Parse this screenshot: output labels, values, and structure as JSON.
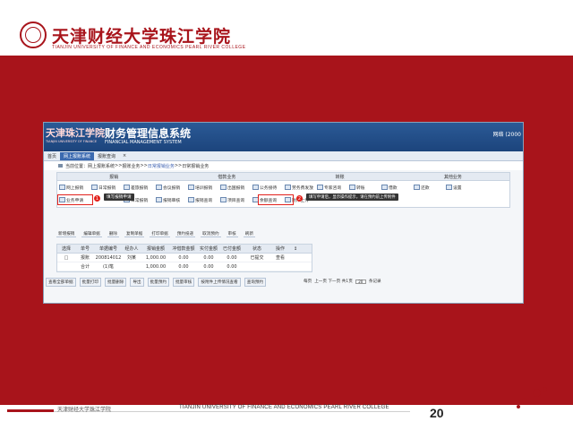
{
  "slide": {
    "logo_cn": "天津财经大学珠江学院",
    "logo_en": "TIANJIN UNIVERSITY OF FINANCE AND ECONOMICS PEARL RIVER COLLEGE",
    "footer_cn": "天津财经大学珠江学院",
    "footer_en": "TIANJIN UNIVERSITY OF FINANCE AND ECONOMICS PEARL RIVER COLLEGE",
    "page_number": "20",
    "colors": {
      "brand": "#a8141b",
      "app_header": "#1c447c",
      "highlight": "#e2211c"
    }
  },
  "app": {
    "logo": "天津珠江学院",
    "logo_sub": "TIANJIN UNIVERSITY OF FINANCE",
    "title": "财务管理信息系统",
    "subtitle": "FINANCIAL MANAGEMENT SYSTEM",
    "user": "网络 (2000",
    "nav": [
      "首页",
      "网上报账系统",
      "报账查询",
      "×"
    ],
    "breadcrumb": [
      "当前位置：",
      "网上报账系统",
      ">>",
      "报账业务",
      ">>",
      "日常报销业务",
      ">>",
      "日常报销业务"
    ],
    "menu_headers": [
      "报销",
      "借款业务",
      "转账",
      "其他业务"
    ],
    "menu_row1": [
      "网上报销",
      "日常报销",
      "差旅报销",
      "会议报销",
      "培训报销",
      "出国报销",
      "公务接待",
      "劳务费发放",
      "专家咨询",
      "转账",
      "借款",
      "还款",
      "设置"
    ],
    "menu_row2": [
      "业务申请",
      "",
      "日常报销",
      "报销审核",
      "报销查询",
      "项目查询",
      "余额查询",
      "附件上传",
      "",
      "",
      "",
      "",
      ""
    ],
    "highlight1_label": "业务申请",
    "tip1": "填写报销申请",
    "highlight2_label": "附件上传",
    "tip2": "填写申请后，显示操作提示，请在预约前上传附件",
    "toolbar": [
      "新增报销",
      "编辑单据",
      "删除",
      "复制单据",
      "打印单据",
      "预约投递",
      "取消预约",
      "审核",
      "刷新"
    ],
    "grid_headers": [
      "选择",
      "单号",
      "单据编号",
      "经办人",
      "报销金额",
      "冲借款金额",
      "实付金额",
      "已付金额",
      "状态",
      "操作",
      "↕"
    ],
    "grid_rows": [
      [
        "□",
        "报账",
        "200814012",
        "刘某",
        "1,000.00",
        "0.00",
        "0.00",
        "0.00",
        "已提交",
        "查看",
        ""
      ],
      [
        "",
        "合计",
        "(1)笔",
        "",
        "1,000.00",
        "0.00",
        "0.00",
        "0.00",
        "",
        "",
        ""
      ]
    ],
    "bottom_buttons": [
      "查看全部单据",
      "批量打印",
      "批量删除",
      "导出",
      "批量预约",
      "批量审核",
      "按附件上传情况查看",
      "查询预约"
    ],
    "pager": {
      "prefix": "每页",
      "nav": "上一页 下一页 共1页",
      "size": "20",
      "suffix": "条记录"
    }
  }
}
